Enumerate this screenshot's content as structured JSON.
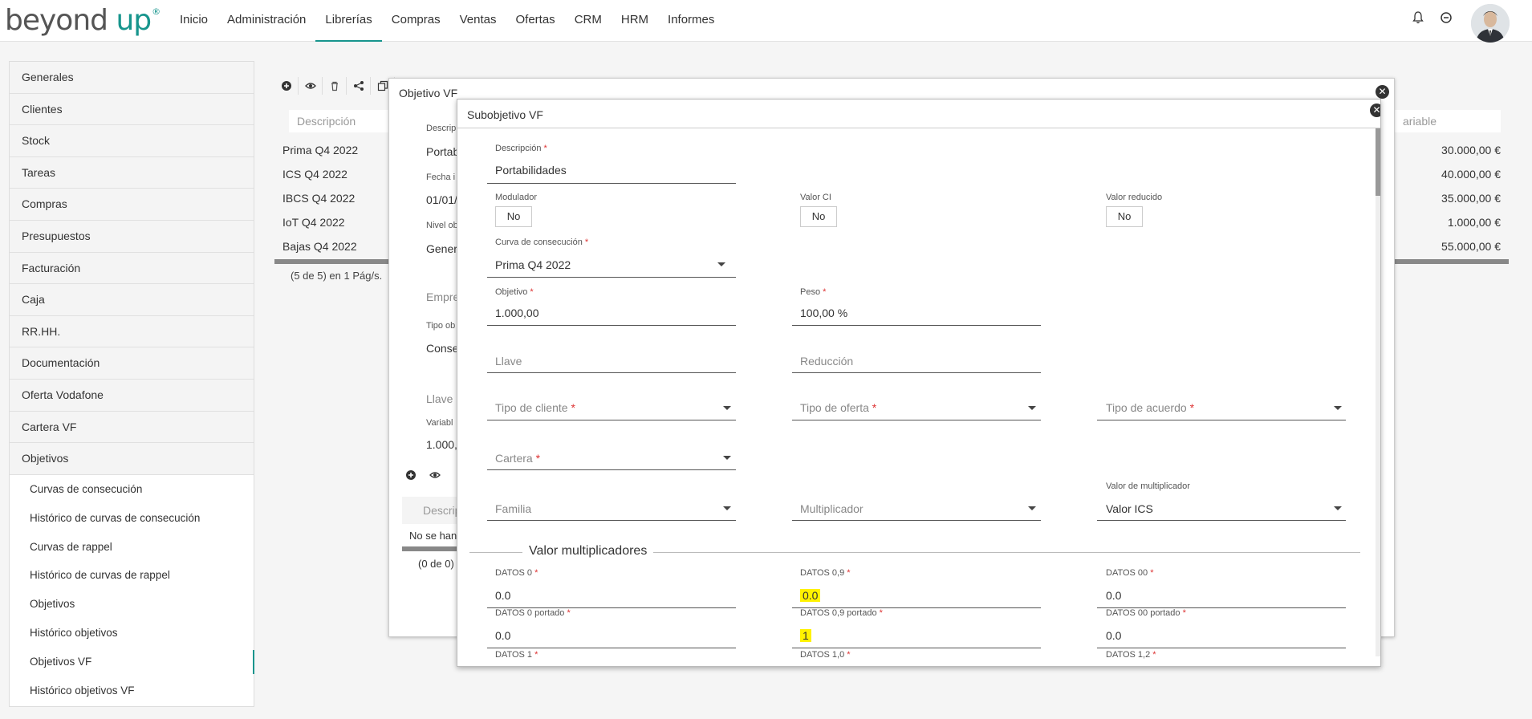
{
  "app": {
    "logo_main": "beyond ",
    "logo_accent": "up",
    "logo_mark": "®"
  },
  "nav": {
    "items": [
      "Inicio",
      "Administración",
      "Librerías",
      "Compras",
      "Ventas",
      "Ofertas",
      "CRM",
      "HRM",
      "Informes"
    ],
    "active": "Librerías"
  },
  "sidebar": {
    "items": [
      "Generales",
      "Clientes",
      "Stock",
      "Tareas",
      "Compras",
      "Presupuestos",
      "Facturación",
      "Caja",
      "RR.HH.",
      "Documentación",
      "Oferta Vodafone",
      "Cartera VF",
      "Objetivos"
    ],
    "subitems": [
      "Curvas de consecución",
      "Histórico de curvas de consecución",
      "Curvas de rappel",
      "Histórico de curvas de rappel",
      "Objetivos",
      "Histórico objetivos",
      "Objetivos VF",
      "Histórico objetivos VF"
    ],
    "active_subitem": "Objetivos VF"
  },
  "bg_table": {
    "filter_desc_placeholder": "Descripción",
    "filter_var_placeholder": "ariable",
    "rows": [
      {
        "desc": "Prima Q4 2022",
        "value": "30.000,00 €"
      },
      {
        "desc": "ICS Q4 2022",
        "value": "40.000,00 €"
      },
      {
        "desc": "IBCS Q4 2022",
        "value": "35.000,00 €"
      },
      {
        "desc": "IoT Q4 2022",
        "value": "1.000,00 €"
      },
      {
        "desc": "Bajas Q4 2022",
        "value": "55.000,00 €"
      }
    ],
    "pager": "(5 de 5) en 1 Pág/s."
  },
  "modal1": {
    "title": "Objetivo VF",
    "desc_label": "Descrip",
    "desc_value": "Portab",
    "fecha_label": "Fecha i",
    "fecha_value": "01/01/",
    "nivel_label": "Nivel ob",
    "nivel_value": "Gener",
    "empresa_placeholder": "Empre",
    "tipo_label": "Tipo ob",
    "tipo_value": "Conse",
    "llave_placeholder": "Llave p",
    "variable_label": "Variabl",
    "variable_value": "1.000,",
    "sub_filter_placeholder": "Descrip",
    "sub_empty": "No se han",
    "sub_pager": "(0 de 0)"
  },
  "modal2": {
    "title": "Subobjetivo VF",
    "descripcion": {
      "label": "Descripción",
      "value": "Portabilidades"
    },
    "modulador": {
      "label": "Modulador",
      "value": "No"
    },
    "valor_ci": {
      "label": "Valor CI",
      "value": "No"
    },
    "valor_reducido": {
      "label": "Valor reducido",
      "value": "No"
    },
    "curva": {
      "label": "Curva de consecución",
      "value": "Prima Q4 2022"
    },
    "objetivo": {
      "label": "Objetivo",
      "value": "1.000,00"
    },
    "peso": {
      "label": "Peso",
      "value": "100,00 %"
    },
    "llave_placeholder": "Llave",
    "reduccion_placeholder": "Reducción",
    "tipo_cliente_placeholder": "Tipo de cliente",
    "tipo_oferta_placeholder": "Tipo de oferta",
    "tipo_acuerdo_placeholder": "Tipo de acuerdo",
    "cartera_placeholder": "Cartera",
    "familia_placeholder": "Familia",
    "multiplicador_placeholder": "Multiplicador",
    "valor_multiplicador": {
      "label": "Valor de multiplicador",
      "value": "Valor ICS"
    },
    "section_title": "Valor multiplicadores",
    "datos0": {
      "label": "DATOS 0",
      "value": "0.0"
    },
    "datos09": {
      "label": "DATOS 0,9",
      "value": "0.0"
    },
    "datos00": {
      "label": "DATOS 00",
      "value": "0.0"
    },
    "datos0p": {
      "label": "DATOS 0 portado",
      "value": "0.0"
    },
    "datos09p": {
      "label": "DATOS 0,9 portado",
      "value": "1"
    },
    "datos00p": {
      "label": "DATOS 00 portado",
      "value": "0.0"
    },
    "datos1": {
      "label": "DATOS 1"
    },
    "datos10": {
      "label": "DATOS 1,0"
    },
    "datos12": {
      "label": "DATOS 1,2"
    },
    "req": "*"
  }
}
